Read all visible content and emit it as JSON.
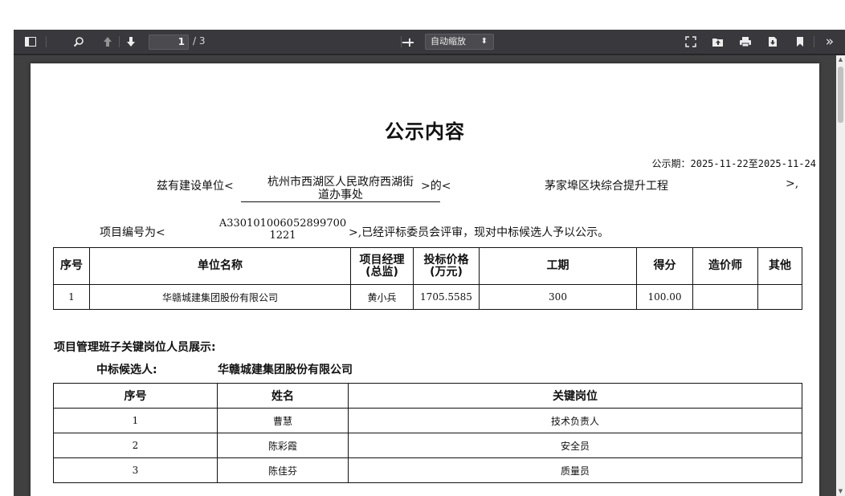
{
  "toolbar": {
    "page_current": "1",
    "page_total": "/ 3",
    "zoom_minus": "−",
    "zoom_plus": "+",
    "zoom_value": "自动缩放",
    "more": "»"
  },
  "document": {
    "title": "公示内容",
    "notice_period": "公示期：2025-11-22至2025-11-24",
    "line1_prefix": "兹有建设单位<",
    "unit_name_line1": "杭州市西湖区人民政府西湖街",
    "unit_name_line2": "道办事处",
    "line1_mid": ">的<",
    "project_name": "茅家埠区块综合提升工程",
    "line1_end": ">,",
    "line2_prefix": "项目编号为<",
    "project_no_line1": "A330101006052899700",
    "project_no_line2": "1221",
    "line2_suffix": ">,已经评标委员会评审，现对中标候选人予以公示。"
  },
  "bid_table": {
    "headers": {
      "no": "序号",
      "company": "单位名称",
      "manager_l1": "项目经理",
      "manager_l2": "(总监)",
      "price_l1": "投标价格",
      "price_l2": "(万元)",
      "period": "工期",
      "score": "得分",
      "cost_engineer": "造价师",
      "other": "其他"
    },
    "rows": [
      {
        "no": "1",
        "company": "华赣城建集团股份有限公司",
        "manager": "黄小兵",
        "price": "1705.5585",
        "period": "300",
        "score": "100.00",
        "cost_engineer": "",
        "other": ""
      }
    ]
  },
  "personnel": {
    "section_title": "项目管理班子关键岗位人员展示:",
    "winner_label": "中标候选人:",
    "winner_name": "华赣城建集团股份有限公司",
    "headers": {
      "no": "序号",
      "name": "姓名",
      "position": "关键岗位"
    },
    "rows": [
      {
        "no": "1",
        "name": "曹慧",
        "position": "技术负责人"
      },
      {
        "no": "2",
        "name": "陈彩霞",
        "position": "安全员"
      },
      {
        "no": "3",
        "name": "陈佳芬",
        "position": "质量员"
      }
    ]
  }
}
